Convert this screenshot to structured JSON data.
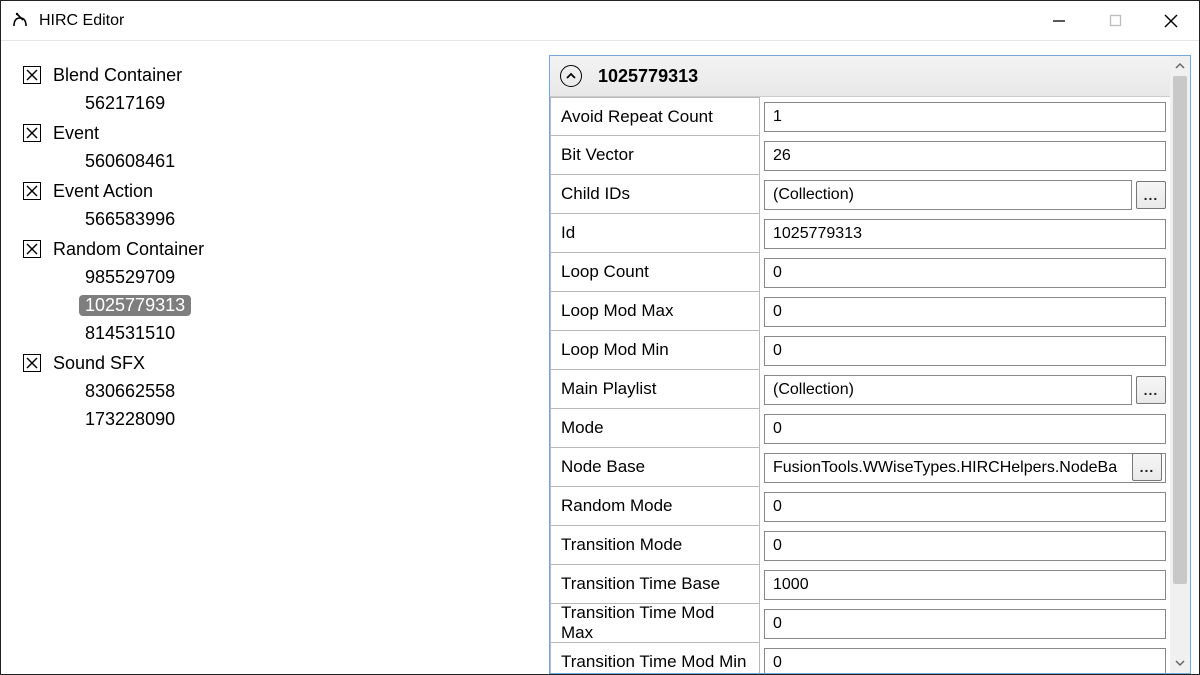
{
  "window": {
    "title": "HIRC Editor"
  },
  "tree": {
    "groups": [
      {
        "label": "Blend Container",
        "children": [
          "56217169"
        ]
      },
      {
        "label": "Event",
        "children": [
          "560608461"
        ]
      },
      {
        "label": "Event Action",
        "children": [
          "566583996"
        ]
      },
      {
        "label": "Random Container",
        "children": [
          "985529709",
          "1025779313",
          "814531510"
        ],
        "selected": "1025779313"
      },
      {
        "label": "Sound SFX",
        "children": [
          "830662558",
          "173228090"
        ]
      }
    ]
  },
  "panel": {
    "title": "1025779313",
    "rows": [
      {
        "label": "Avoid Repeat Count",
        "value": "1"
      },
      {
        "label": "Bit Vector",
        "value": "26"
      },
      {
        "label": "Child IDs",
        "value": "(Collection)",
        "collection": true
      },
      {
        "label": "Id",
        "value": "1025779313"
      },
      {
        "label": "Loop Count",
        "value": "0"
      },
      {
        "label": "Loop Mod Max",
        "value": "0"
      },
      {
        "label": "Loop Mod Min",
        "value": "0"
      },
      {
        "label": "Main Playlist",
        "value": "(Collection)",
        "collection": true
      },
      {
        "label": "Mode",
        "value": "0"
      },
      {
        "label": "Node Base",
        "value": "FusionTools.WWiseTypes.HIRCHelpers.NodeBa",
        "overflowBtn": true
      },
      {
        "label": "Random Mode",
        "value": "0"
      },
      {
        "label": "Transition Mode",
        "value": "0"
      },
      {
        "label": "Transition Time Base",
        "value": "1000"
      },
      {
        "label": "Transition Time Mod Max",
        "value": "0"
      },
      {
        "label": "Transition Time Mod Min",
        "value": "0"
      }
    ],
    "ellipsis_label": "..."
  }
}
